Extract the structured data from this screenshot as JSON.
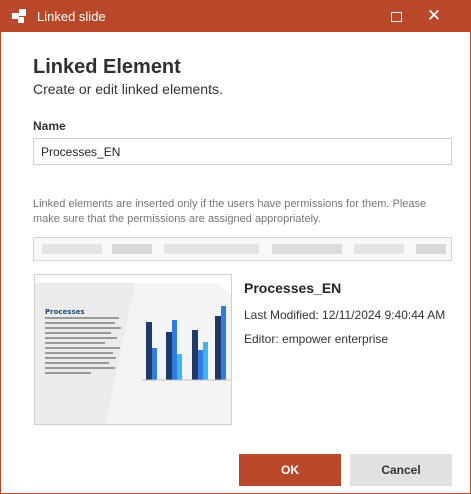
{
  "window": {
    "title": "Linked slide",
    "icon": "powerpoint-linked-slide-icon",
    "accent_color": "#b9472a"
  },
  "controls": {
    "maximize_icon": "maximize-icon",
    "close_glyph": "✕"
  },
  "header": {
    "title": "Linked Element",
    "subtitle": "Create or edit linked elements."
  },
  "name_field": {
    "label": "Name",
    "value": "Processes_EN"
  },
  "info": {
    "text": "Linked elements are inserted only if the users have permissions for them. Please make sure that the permissions are assigned appropriately."
  },
  "preview": {
    "slide_title": "Processes",
    "file_name": "Processes_EN",
    "last_modified": "Last Modified: 12/11/2024 9:40:44 AM",
    "editor": "Editor: empower enterprise"
  },
  "buttons": {
    "ok": "OK",
    "cancel": "Cancel"
  }
}
